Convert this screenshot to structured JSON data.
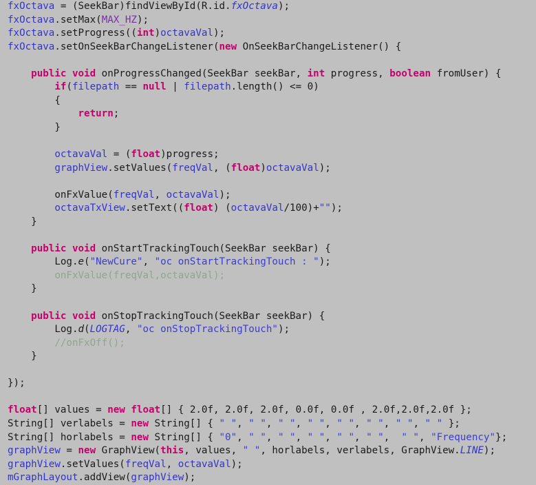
{
  "editor": {
    "name": "java-code-editor",
    "background_color": "#c0c0c0",
    "language": "Java",
    "colors": {
      "plain": "#1a1a1a",
      "field": "#3333cc",
      "static_constant": "#7b2fa8",
      "keyword": "#c4006a",
      "string": "#3c3cd0",
      "comment": "#8fa58f"
    }
  },
  "code": {
    "lines": [
      {
        "n": 1,
        "text": "fxOctava = (SeekBar)findViewById(R.id.fxOctava);"
      },
      {
        "n": 2,
        "text": "fxOctava.setMax(MAX_HZ);"
      },
      {
        "n": 3,
        "text": "fxOctava.setProgress((int)octavaVal);"
      },
      {
        "n": 4,
        "text": "fxOctava.setOnSeekBarChangeListener(new OnSeekBarChangeListener() {"
      },
      {
        "n": 5,
        "text": ""
      },
      {
        "n": 6,
        "text": "    public void onProgressChanged(SeekBar seekBar, int progress, boolean fromUser) {"
      },
      {
        "n": 7,
        "text": "        if(filepath == null | filepath.length() <= 0)"
      },
      {
        "n": 8,
        "text": "        {"
      },
      {
        "n": 9,
        "text": "            return;"
      },
      {
        "n": 10,
        "text": "        }"
      },
      {
        "n": 11,
        "text": ""
      },
      {
        "n": 12,
        "text": "        octavaVal = (float)progress;"
      },
      {
        "n": 13,
        "text": "        graphView.setValues(freqVal, (float)octavaVal);"
      },
      {
        "n": 14,
        "text": ""
      },
      {
        "n": 15,
        "text": "        onFxValue(freqVal, octavaVal);"
      },
      {
        "n": 16,
        "text": "        octavaTxView.setText((float) (octavaVal/100)+\"\");"
      },
      {
        "n": 17,
        "text": "    }"
      },
      {
        "n": 18,
        "text": ""
      },
      {
        "n": 19,
        "text": "    public void onStartTrackingTouch(SeekBar seekBar) {"
      },
      {
        "n": 20,
        "text": "        Log.e(\"NewCure\", \"oc onStartTrackingTouch : \");"
      },
      {
        "n": 21,
        "text": "        onFxValue(freqVal,octavaVal);"
      },
      {
        "n": 22,
        "text": "    }"
      },
      {
        "n": 23,
        "text": ""
      },
      {
        "n": 24,
        "text": "    public void onStopTrackingTouch(SeekBar seekBar) {"
      },
      {
        "n": 25,
        "text": "        Log.d(LOGTAG, \"oc onStopTrackingTouch\");"
      },
      {
        "n": 26,
        "text": "        //onFxOff();"
      },
      {
        "n": 27,
        "text": "    }"
      },
      {
        "n": 28,
        "text": ""
      },
      {
        "n": 29,
        "text": "});"
      },
      {
        "n": 30,
        "text": ""
      },
      {
        "n": 31,
        "text": "float[] values = new float[] { 2.0f, 2.0f, 2.0f, 0.0f, 0.0f , 2.0f,2.0f,2.0f };"
      },
      {
        "n": 32,
        "text": "String[] verlabels = new String[] { \" \", \" \", \" \", \" \", \" \", \" \", \" \", \" \" };"
      },
      {
        "n": 33,
        "text": "String[] horlabels = new String[] { \"0\", \" \", \" \", \" \", \" \", \" \",  \" \", \"Frequency\"};"
      },
      {
        "n": 34,
        "text": "graphView = new GraphView(this, values, \" \", horlabels, verlabels, GraphView.LINE);"
      },
      {
        "n": 35,
        "text": "graphView.setValues(freqVal, octavaVal);"
      },
      {
        "n": 36,
        "text": "mGraphLayout.addView(graphView);"
      }
    ],
    "tokens": {
      "line1": [
        [
          "fxOctava",
          "field"
        ],
        [
          " = (SeekBar)findViewById(R.id.",
          "plain"
        ],
        [
          "fxOctava",
          "italic"
        ],
        [
          ");",
          "plain"
        ]
      ],
      "line2": [
        [
          "fxOctava",
          "field"
        ],
        [
          ".setMax(",
          "plain"
        ],
        [
          "MAX_HZ",
          "static"
        ],
        [
          ");",
          "plain"
        ]
      ],
      "line3": [
        [
          "fxOctava",
          "field"
        ],
        [
          ".setProgress((",
          "plain"
        ],
        [
          "int",
          "keyword"
        ],
        [
          ")",
          "plain"
        ],
        [
          "octavaVal",
          "field"
        ],
        [
          ");",
          "plain"
        ]
      ],
      "line4": [
        [
          "fxOctava",
          "field"
        ],
        [
          ".setOnSeekBarChangeListener(",
          "plain"
        ],
        [
          "new",
          "keyword"
        ],
        [
          " OnSeekBarChangeListener() {",
          "plain"
        ]
      ],
      "line6": [
        [
          "    ",
          "plain"
        ],
        [
          "public",
          "keyword"
        ],
        [
          " ",
          "plain"
        ],
        [
          "void",
          "keyword"
        ],
        [
          " onProgressChanged(SeekBar seekBar, ",
          "plain"
        ],
        [
          "int",
          "keyword"
        ],
        [
          " progress, ",
          "plain"
        ],
        [
          "boolean",
          "keyword"
        ],
        [
          " fromUser) {",
          "plain"
        ]
      ],
      "line7": [
        [
          "        ",
          "plain"
        ],
        [
          "if",
          "keyword"
        ],
        [
          "(",
          "plain"
        ],
        [
          "filepath",
          "field"
        ],
        [
          " == ",
          "plain"
        ],
        [
          "null",
          "keyword"
        ],
        [
          " | ",
          "plain"
        ],
        [
          "filepath",
          "field"
        ],
        [
          ".length() <= 0)",
          "plain"
        ]
      ],
      "line8": [
        [
          "        {",
          "plain"
        ]
      ],
      "line9": [
        [
          "            ",
          "plain"
        ],
        [
          "return",
          "keyword"
        ],
        [
          ";",
          "plain"
        ]
      ],
      "line10": [
        [
          "        }",
          "plain"
        ]
      ],
      "line12": [
        [
          "        ",
          "plain"
        ],
        [
          "octavaVal",
          "field"
        ],
        [
          " = (",
          "plain"
        ],
        [
          "float",
          "keyword"
        ],
        [
          ")progress;",
          "plain"
        ]
      ],
      "line13": [
        [
          "        ",
          "plain"
        ],
        [
          "graphView",
          "field"
        ],
        [
          ".setValues(",
          "plain"
        ],
        [
          "freqVal",
          "field"
        ],
        [
          ", (",
          "plain"
        ],
        [
          "float",
          "keyword"
        ],
        [
          ")",
          "plain"
        ],
        [
          "octavaVal",
          "field"
        ],
        [
          ");",
          "plain"
        ]
      ],
      "line15": [
        [
          "        onFxValue(",
          "plain"
        ],
        [
          "freqVal",
          "field"
        ],
        [
          ", ",
          "plain"
        ],
        [
          "octavaVal",
          "field"
        ],
        [
          ");",
          "plain"
        ]
      ],
      "line16": [
        [
          "        ",
          "plain"
        ],
        [
          "octavaTxView",
          "field"
        ],
        [
          ".setText((",
          "plain"
        ],
        [
          "float",
          "keyword"
        ],
        [
          ") (",
          "plain"
        ],
        [
          "octavaVal",
          "field"
        ],
        [
          "/100)+",
          "plain"
        ],
        [
          "\"\"",
          "string"
        ],
        [
          ");",
          "plain"
        ]
      ],
      "line17": [
        [
          "    }",
          "plain"
        ]
      ],
      "line19": [
        [
          "    ",
          "plain"
        ],
        [
          "public",
          "keyword"
        ],
        [
          " ",
          "plain"
        ],
        [
          "void",
          "keyword"
        ],
        [
          " onStartTrackingTouch(SeekBar seekBar) {",
          "plain"
        ]
      ],
      "line20": [
        [
          "        Log.",
          "plain"
        ],
        [
          "e",
          "italicm"
        ],
        [
          "(",
          "plain"
        ],
        [
          "\"NewCure\"",
          "string"
        ],
        [
          ", ",
          "plain"
        ],
        [
          "\"oc onStartTrackingTouch : \"",
          "string"
        ],
        [
          ");",
          "plain"
        ]
      ],
      "line21": [
        [
          "        onFxValue(freqVal,octavaVal);",
          "comment"
        ]
      ],
      "line22": [
        [
          "    }",
          "plain"
        ]
      ],
      "line24": [
        [
          "    ",
          "plain"
        ],
        [
          "public",
          "keyword"
        ],
        [
          " ",
          "plain"
        ],
        [
          "void",
          "keyword"
        ],
        [
          " onStopTrackingTouch(SeekBar seekBar) {",
          "plain"
        ]
      ],
      "line25": [
        [
          "        Log.",
          "plain"
        ],
        [
          "d",
          "italicm"
        ],
        [
          "(",
          "plain"
        ],
        [
          "LOGTAG",
          "italic"
        ],
        [
          ", ",
          "plain"
        ],
        [
          "\"oc onStopTrackingTouch\"",
          "string"
        ],
        [
          ");",
          "plain"
        ]
      ],
      "line26": [
        [
          "        //onFxOff();",
          "comment"
        ]
      ],
      "line27": [
        [
          "    }",
          "plain"
        ]
      ],
      "line29": [
        [
          "});",
          "plain"
        ]
      ],
      "line31": [
        [
          "float",
          "keyword"
        ],
        [
          "[] values = ",
          "plain"
        ],
        [
          "new",
          "keyword"
        ],
        [
          " ",
          "plain"
        ],
        [
          "float",
          "keyword"
        ],
        [
          "[] { 2.0f, 2.0f, 2.0f, 0.0f, 0.0f , 2.0f,2.0f,2.0f };",
          "plain"
        ]
      ],
      "line32": [
        [
          "String[] verlabels = ",
          "plain"
        ],
        [
          "new",
          "keyword"
        ],
        [
          " String[] { ",
          "plain"
        ],
        [
          "\" \"",
          "string"
        ],
        [
          ", ",
          "plain"
        ],
        [
          "\" \"",
          "string"
        ],
        [
          ", ",
          "plain"
        ],
        [
          "\" \"",
          "string"
        ],
        [
          ", ",
          "plain"
        ],
        [
          "\" \"",
          "string"
        ],
        [
          ", ",
          "plain"
        ],
        [
          "\" \"",
          "string"
        ],
        [
          ", ",
          "plain"
        ],
        [
          "\" \"",
          "string"
        ],
        [
          ", ",
          "plain"
        ],
        [
          "\" \"",
          "string"
        ],
        [
          ", ",
          "plain"
        ],
        [
          "\" \"",
          "string"
        ],
        [
          " };",
          "plain"
        ]
      ],
      "line33": [
        [
          "String[] horlabels = ",
          "plain"
        ],
        [
          "new",
          "keyword"
        ],
        [
          " String[] { ",
          "plain"
        ],
        [
          "\"0\"",
          "string"
        ],
        [
          ", ",
          "plain"
        ],
        [
          "\" \"",
          "string"
        ],
        [
          ", ",
          "plain"
        ],
        [
          "\" \"",
          "string"
        ],
        [
          ", ",
          "plain"
        ],
        [
          "\" \"",
          "string"
        ],
        [
          ", ",
          "plain"
        ],
        [
          "\" \"",
          "string"
        ],
        [
          ", ",
          "plain"
        ],
        [
          "\" \"",
          "string"
        ],
        [
          ",  ",
          "plain"
        ],
        [
          "\" \"",
          "string"
        ],
        [
          ", ",
          "plain"
        ],
        [
          "\"Frequency\"",
          "string"
        ],
        [
          "};",
          "plain"
        ]
      ],
      "line34": [
        [
          "graphView",
          "field"
        ],
        [
          " = ",
          "plain"
        ],
        [
          "new",
          "keyword"
        ],
        [
          " GraphView(",
          "plain"
        ],
        [
          "this",
          "keyword"
        ],
        [
          ", values, ",
          "plain"
        ],
        [
          "\" \"",
          "string"
        ],
        [
          ", horlabels, verlabels, GraphView.",
          "plain"
        ],
        [
          "LINE",
          "italic"
        ],
        [
          ");",
          "plain"
        ]
      ],
      "line35": [
        [
          "graphView",
          "field"
        ],
        [
          ".setValues(",
          "plain"
        ],
        [
          "freqVal",
          "field"
        ],
        [
          ", ",
          "plain"
        ],
        [
          "octavaVal",
          "field"
        ],
        [
          ");",
          "plain"
        ]
      ],
      "line36": [
        [
          "mGraphLayout",
          "field"
        ],
        [
          ".addView(",
          "plain"
        ],
        [
          "graphView",
          "field"
        ],
        [
          ");",
          "plain"
        ]
      ]
    }
  }
}
